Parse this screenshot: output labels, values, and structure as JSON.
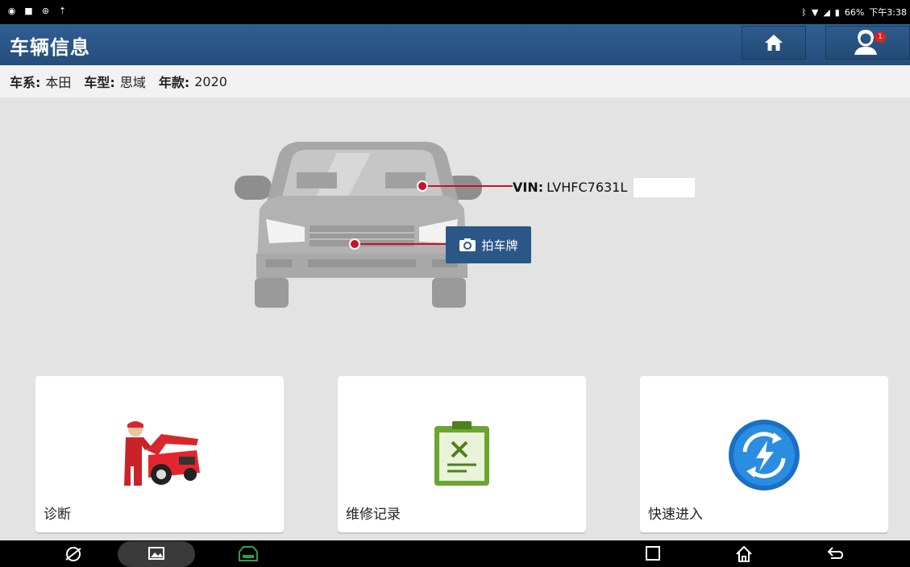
{
  "status_bar": {
    "battery": "66%",
    "time": "下午3:38"
  },
  "header": {
    "title": "车辆信息"
  },
  "vehicle_info": {
    "brand_label": "车系:",
    "brand_value": "本田",
    "model_label": "车型:",
    "model_value": "思域",
    "year_label": "年款:",
    "year_value": "2020"
  },
  "vin": {
    "label": "VIN:",
    "value": "LVHFC7631L"
  },
  "plate_button": {
    "label": "拍车牌"
  },
  "tiles": [
    {
      "label": "诊断",
      "icon": "mechanic-car-icon"
    },
    {
      "label": "维修记录",
      "icon": "repair-record-clipboard-icon"
    },
    {
      "label": "快速进入",
      "icon": "quick-access-icon"
    }
  ],
  "support": {
    "badge_count": "1"
  },
  "colors": {
    "header_blue": "#2f5f93",
    "accent_red": "#c8102e",
    "plate_button": "#2b5786"
  }
}
